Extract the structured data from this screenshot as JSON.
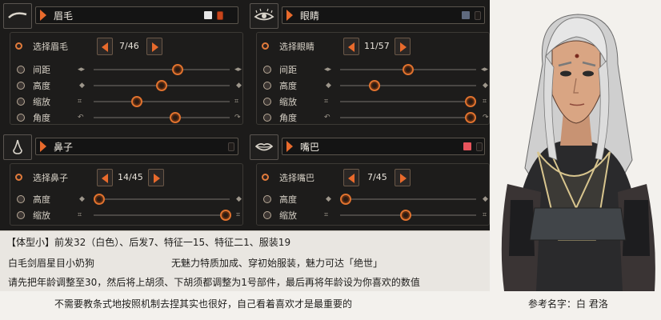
{
  "panels": {
    "eyebrow": {
      "title": "眉毛",
      "icon": "eyebrow-icon",
      "swatch_color": "#e7e7e7",
      "select_label": "选择眉毛",
      "select_value": "7/46",
      "sliders": [
        {
          "label": "间距",
          "value": 0.62
        },
        {
          "label": "高度",
          "value": 0.5
        },
        {
          "label": "缩放",
          "value": 0.32
        },
        {
          "label": "角度",
          "value": 0.6
        }
      ]
    },
    "eyes": {
      "title": "眼睛",
      "icon": "eye-icon",
      "swatch_color": "#5f6a7e",
      "select_label": "选择眼睛",
      "select_value": "11/57",
      "sliders": [
        {
          "label": "间距",
          "value": 0.5
        },
        {
          "label": "高度",
          "value": 0.25
        },
        {
          "label": "缩放",
          "value": 0.96
        },
        {
          "label": "角度",
          "value": 0.96
        }
      ]
    },
    "nose": {
      "title": "鼻子",
      "icon": "nose-icon",
      "select_label": "选择鼻子",
      "select_value": "14/45",
      "sliders": [
        {
          "label": "高度",
          "value": 0.04
        },
        {
          "label": "缩放",
          "value": 0.97
        }
      ]
    },
    "mouth": {
      "title": "嘴巴",
      "icon": "mouth-icon",
      "swatch_color": "#e8545c",
      "select_label": "选择嘴巴",
      "select_value": "7/45",
      "sliders": [
        {
          "label": "高度",
          "value": 0.04
        },
        {
          "label": "缩放",
          "value": 0.48
        }
      ]
    }
  },
  "caption": {
    "line1": "【体型小】前发32（白色）、后发7、特征一15、特征二1、服装19",
    "line2_left": "白毛剑眉星目小奶狗",
    "line2_right": "无魅力特质加成、穿初始服装，魅力可达「绝世」",
    "line3": "请先把年龄调整至30，然后将上胡须、下胡须都调整为1号部件，最后再将年龄设为你喜欢的数值",
    "line4": "不需要教条式地按照机制去捏其实也很好，自己看着喜欢才是最重要的",
    "reference_name": "参考名字：白 君洛"
  }
}
